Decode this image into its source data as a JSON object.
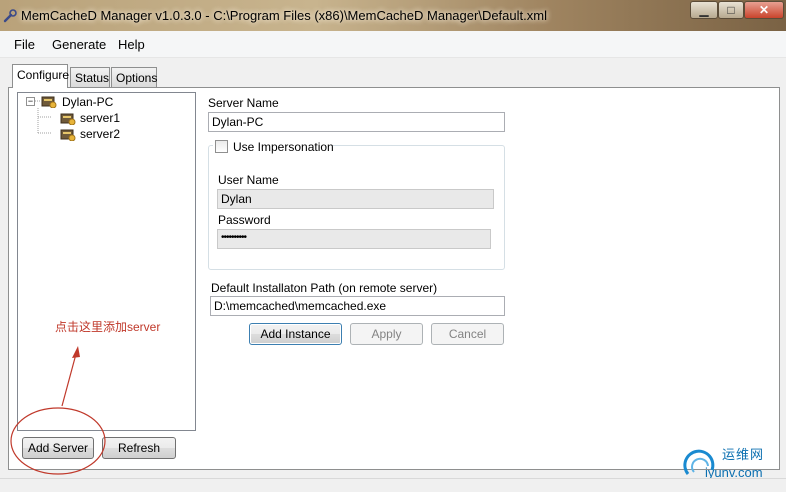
{
  "window": {
    "title": "MemCacheD Manager v1.0.3.0 - C:\\Program Files (x86)\\MemCacheD Manager\\Default.xml"
  },
  "menu": [
    "File",
    "Generate",
    "Help"
  ],
  "tabs": [
    "Configure",
    "Status",
    "Options"
  ],
  "tree": {
    "root": "Dylan-PC",
    "children": [
      "server1",
      "server2"
    ]
  },
  "form": {
    "server_name_label": "Server Name",
    "server_name_value": "Dylan-PC",
    "impersonation_label": "Use Impersonation",
    "impersonation_checked": false,
    "user_name_label": "User Name",
    "user_name_value": "Dylan",
    "password_label": "Password",
    "password_value": "••••••••••",
    "path_label": "Default Installaton Path (on remote server)",
    "path_value": "D:\\memcached\\memcached.exe"
  },
  "buttons": {
    "add_instance": "Add Instance",
    "apply": "Apply",
    "cancel": "Cancel",
    "add_server": "Add Server",
    "refresh": "Refresh"
  },
  "annotation": "点击这里添加server",
  "watermark": {
    "line1": "运维网",
    "line2": "iyunv.com"
  },
  "colors": {
    "annotation": "#c0392b",
    "close_button": "#c9442c"
  }
}
